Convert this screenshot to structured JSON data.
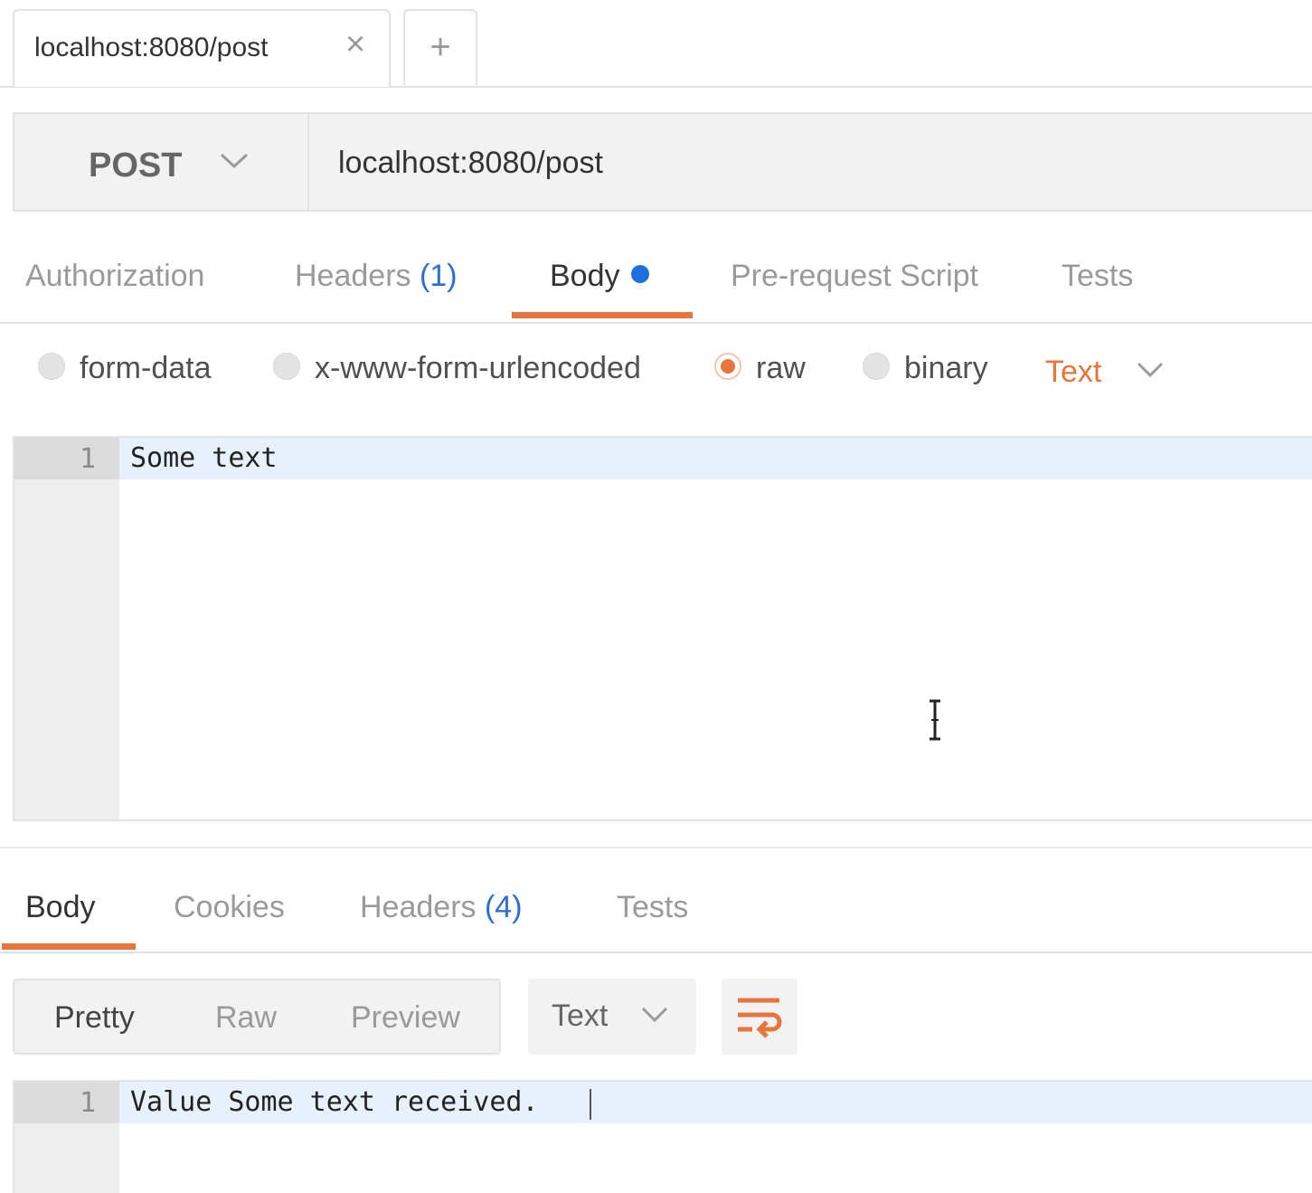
{
  "tab": {
    "title": "localhost:8080/post",
    "close_icon": "close-icon",
    "new_tab_symbol": "+"
  },
  "request": {
    "method": "POST",
    "url": "localhost:8080/post"
  },
  "request_tabs": {
    "authorization": "Authorization",
    "headers_label": "Headers",
    "headers_count": "(1)",
    "body": "Body",
    "prerequest": "Pre-request Script",
    "tests": "Tests",
    "active": "Body"
  },
  "body_types": {
    "form_data": "form-data",
    "urlencoded": "x-www-form-urlencoded",
    "raw": "raw",
    "binary": "binary",
    "selected": "raw",
    "format": "Text"
  },
  "request_editor": {
    "line_number": "1",
    "line_text": "Some text"
  },
  "response_tabs": {
    "body": "Body",
    "cookies": "Cookies",
    "headers_label": "Headers",
    "headers_count": "(4)",
    "tests": "Tests",
    "active": "Body"
  },
  "response_view": {
    "pretty": "Pretty",
    "raw": "Raw",
    "preview": "Preview",
    "active": "Pretty",
    "format": "Text"
  },
  "response_editor": {
    "line_number": "1",
    "line_text": "Value Some text received."
  },
  "colors": {
    "accent": "#e7753e",
    "dot_blue": "#1e6fdb",
    "count_blue": "#2c6fd3"
  }
}
